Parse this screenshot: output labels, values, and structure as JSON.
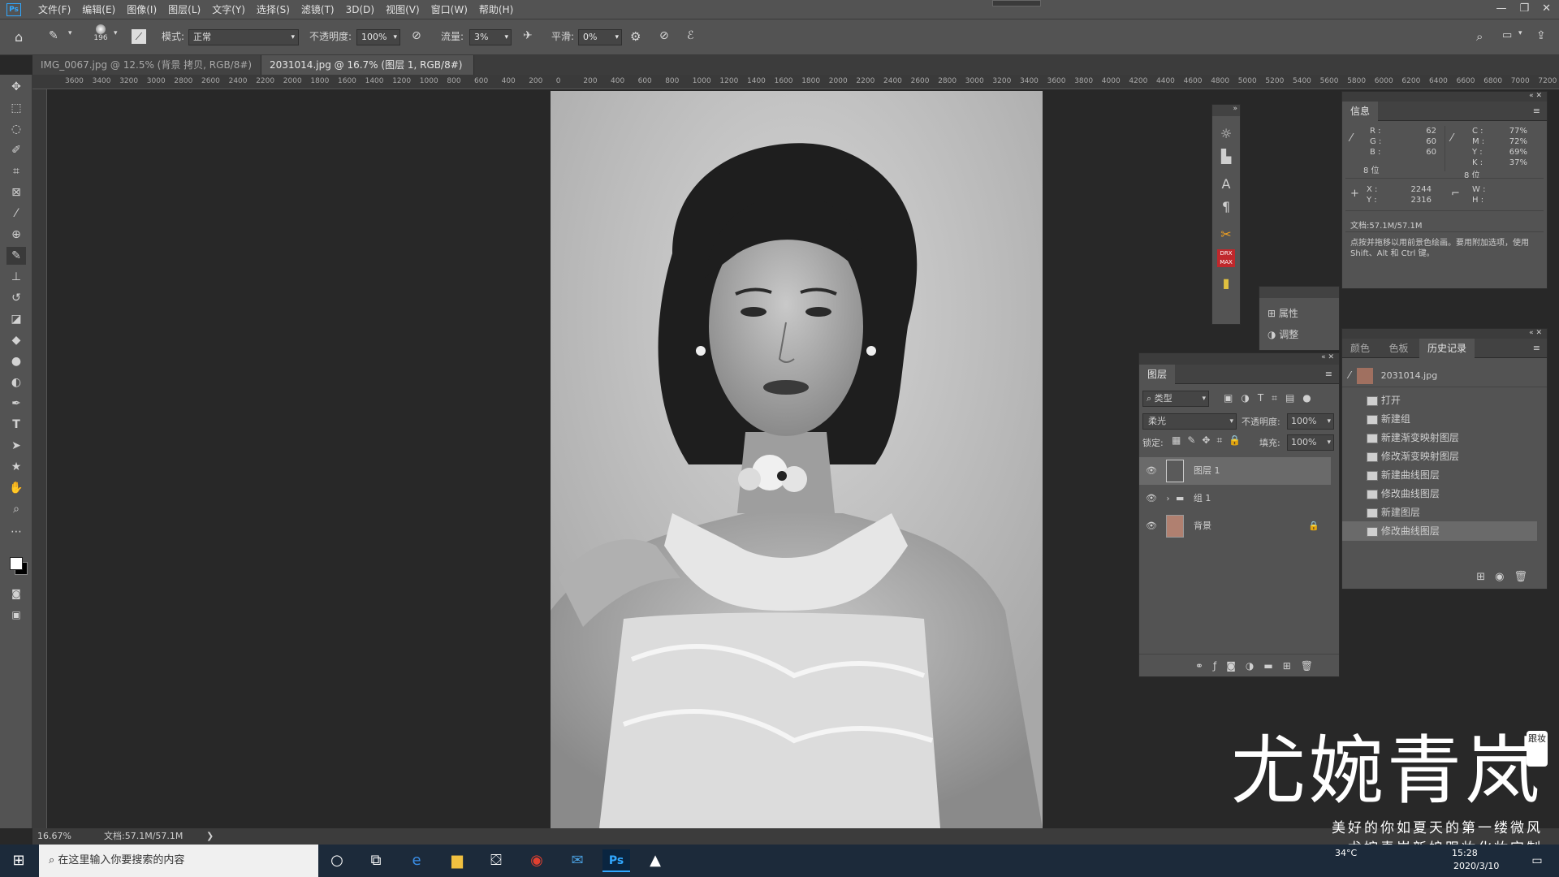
{
  "menubar": {
    "logo": "Ps",
    "items": [
      "文件(F)",
      "编辑(E)",
      "图像(I)",
      "图层(L)",
      "文字(Y)",
      "选择(S)",
      "滤镜(T)",
      "3D(D)",
      "视图(V)",
      "窗口(W)",
      "帮助(H)"
    ],
    "window_controls": [
      "—",
      "❐",
      "✕"
    ]
  },
  "options": {
    "brush_size": "196",
    "mode_label": "模式:",
    "mode_value": "正常",
    "opacity_label": "不透明度:",
    "opacity_value": "100%",
    "flow_label": "流量:",
    "flow_value": "3%",
    "smoothing_label": "平滑:",
    "smoothing_value": "0%"
  },
  "tabs": [
    {
      "label": "IMG_0067.jpg @ 12.5% (背景 拷贝, RGB/8#) *",
      "close": "×"
    },
    {
      "label": "2031014.jpg @ 16.7% (图层 1, RGB/8#) *",
      "close": "×"
    }
  ],
  "ruler": {
    "ticks": [
      "3600",
      "3400",
      "3200",
      "3000",
      "2800",
      "2600",
      "2400",
      "2200",
      "2000",
      "1800",
      "1600",
      "1400",
      "1200",
      "1000",
      "800",
      "600",
      "400",
      "200",
      "0",
      "200",
      "400",
      "600",
      "800",
      "1000",
      "1200",
      "1400",
      "1600",
      "1800",
      "2000",
      "2200",
      "2400",
      "2600",
      "2800",
      "3000",
      "3200",
      "3400",
      "3600",
      "3800",
      "4000",
      "4200",
      "4400",
      "4600",
      "4800",
      "5000",
      "5200",
      "5400",
      "5600",
      "5800",
      "6000",
      "6200",
      "6400",
      "6600",
      "6800",
      "7000",
      "7200"
    ]
  },
  "status": {
    "zoom": "16.67%",
    "doc": "文档:57.1M/57.1M",
    "arrow": "❯"
  },
  "info_panel": {
    "title": "信息",
    "rgb": {
      "R": "62",
      "G": "60",
      "B": "60"
    },
    "cmyk": {
      "C": "77%",
      "M": "72%",
      "Y": "69%",
      "K": "37%"
    },
    "bits_left": "8 位",
    "bits_right": "8 位",
    "xy": {
      "X": "2244",
      "Y": "2316"
    },
    "wh": {
      "W": "",
      "H": ""
    },
    "doc": "文档:57.1M/57.1M",
    "hint": "点按并拖移以用前景色绘画。要用附加选项，使用 Shift、Alt 和 Ctrl 键。"
  },
  "properties_panel": {
    "items": [
      "属性",
      "调整"
    ]
  },
  "layers_panel": {
    "title": "图层",
    "filter": "类型",
    "blend_mode": "柔光",
    "opacity_label": "不透明度:",
    "opacity_value": "100%",
    "lock_label": "锁定:",
    "fill_label": "填充:",
    "fill_value": "100%",
    "layers": [
      {
        "name": "图层 1"
      },
      {
        "name": "组 1"
      },
      {
        "name": "背景"
      }
    ]
  },
  "history_panel": {
    "tabs": [
      "颜色",
      "色板",
      "历史记录"
    ],
    "snapshot": "2031014.jpg",
    "items": [
      "打开",
      "新建组",
      "新建渐变映射图层",
      "修改渐变映射图层",
      "新建曲线图层",
      "修改曲线图层",
      "新建图层",
      "修改曲线图层"
    ]
  },
  "taskbar": {
    "search_placeholder": "在这里输入你要搜索的内容",
    "temp": "34°C",
    "time": "15:28",
    "date": "2020/3/10"
  },
  "watermark": {
    "big": "尤婉青岚",
    "seal": "跟妆",
    "line1": "美好的你如夏天的第一缕微风",
    "line2": "尤婉青岚新娘跟妆化妆定制"
  },
  "colors": {
    "ui_dark": "#282828",
    "ui_panel": "#535353",
    "ps_blue": "#31a8ff",
    "taskbar": "#1c2a3a"
  }
}
